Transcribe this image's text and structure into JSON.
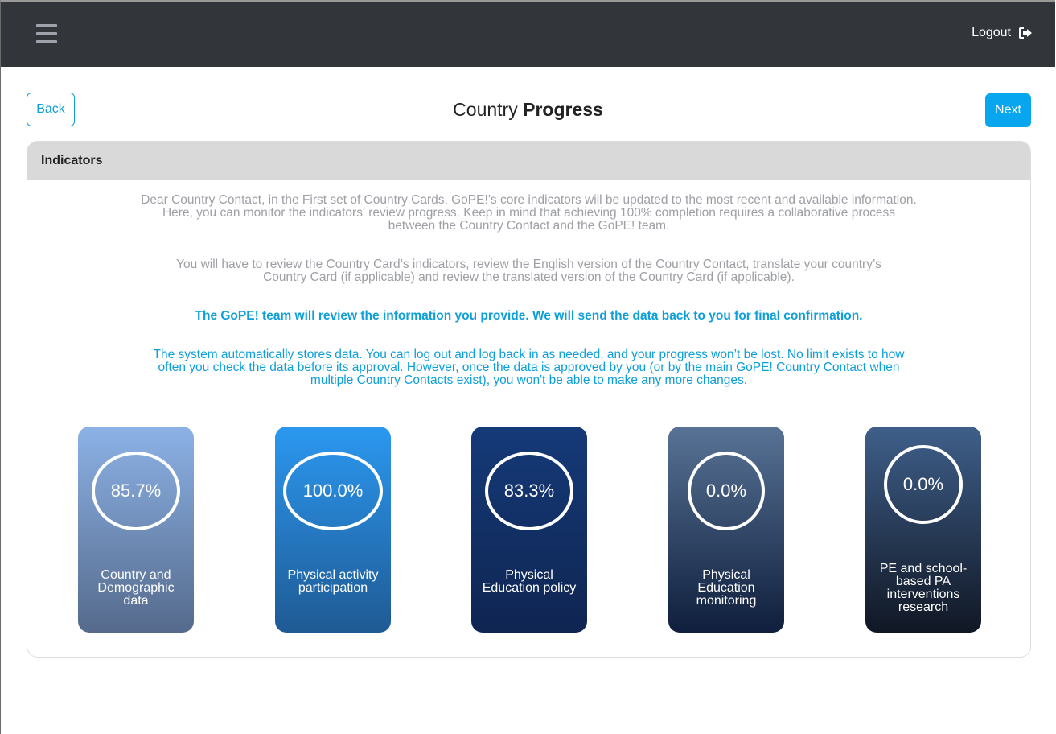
{
  "navbar": {
    "menu_icon": "hamburger-menu-icon",
    "logout_label": "Logout",
    "logout_icon": "sign-out-icon"
  },
  "header": {
    "back_label": "Back",
    "next_label": "Next",
    "title_normal": "Country",
    "title_bold": "Progress"
  },
  "card": {
    "title": "Indicators",
    "paragraphs": [
      "Dear Country Contact, in the First set of Country Cards, GoPE!’s core indicators will be updated to the most recent and available information. Here, you can monitor the indicators' review progress. Keep in mind that achieving 100% completion requires a collaborative process between the Country Contact and the GoPE! team.",
      "You will have to review the Country Card’s indicators, review the English version of the Country Contact, translate your country’s Country Card (if applicable) and review the translated version of the Country Card (if applicable).",
      "The GoPE! team will review the information you provide. We will send the data back to you for final confirmation.",
      "The system automatically stores data. You can log out and log back in as needed, and your progress won’t be lost. No limit exists to how often you check the data before its approval. However, once the data is approved by you (or by the main GoPE! Country Contact when multiple Country Contacts exist), you won't be able to make any more changes."
    ]
  },
  "indicators": [
    {
      "value": "85.7%",
      "label": "Country and Demographic data",
      "progress": 0.857,
      "gradient": [
        "#8cb2e6",
        "#556a8c"
      ]
    },
    {
      "value": "100.0%",
      "label": "Physical activity participation",
      "progress": 1.0,
      "gradient": [
        "#2b98f0",
        "#1f5a94"
      ]
    },
    {
      "value": "83.3%",
      "label": "Physical Education policy",
      "progress": 0.833,
      "gradient": [
        "#153a78",
        "#0f2552"
      ]
    },
    {
      "value": "0.0%",
      "label": "Physical Education monitoring",
      "progress": 0.0,
      "gradient": [
        "#587396",
        "#0f1e3c"
      ]
    },
    {
      "value": "0.0%",
      "label": "PE and school-based PA interventions research",
      "progress": 0.0,
      "gradient": [
        "#3f5f8a",
        "#101724"
      ]
    }
  ],
  "colors": {
    "navbar": "#32353a",
    "accent": "#07a6ef",
    "card_header": "#d9d9d9",
    "muted_text": "#9d9fa5"
  }
}
